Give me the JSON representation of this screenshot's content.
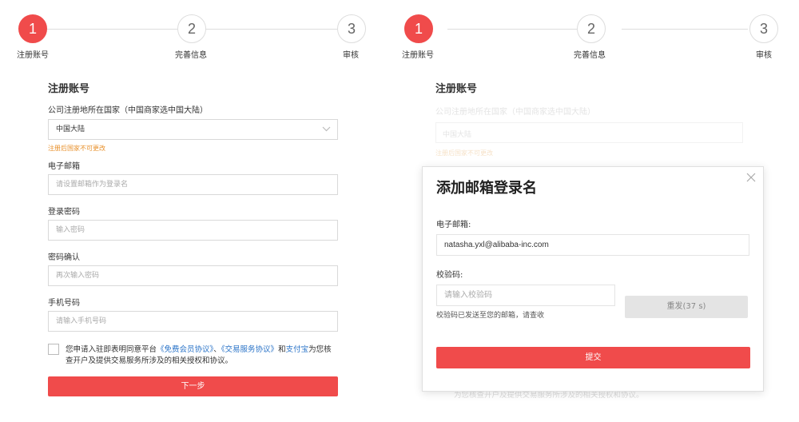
{
  "steps": [
    {
      "number": "1",
      "label": "注册账号",
      "state": "active"
    },
    {
      "number": "2",
      "label": "完善信息",
      "state": "inactive"
    },
    {
      "number": "3",
      "label": "审核",
      "state": "inactive"
    }
  ],
  "colors": {
    "accent": "#f04b4b",
    "link": "#2b74c8",
    "warning": "#e8912c"
  },
  "left_form": {
    "title": "注册账号",
    "country_label": "公司注册地所在国家（中国商家选中国大陆）",
    "country_value": "中国大陆",
    "country_hint": "注册后国家不可更改",
    "email_label": "电子邮箱",
    "email_placeholder": "请设置邮箱作为登录名",
    "password_label": "登录密码",
    "password_placeholder": "输入密码",
    "confirm_label": "密码确认",
    "confirm_placeholder": "再次输入密码",
    "phone_label": "手机号码",
    "phone_placeholder": "请输入手机号码",
    "agreement": {
      "prefix": "您申请入驻即表明同意平台",
      "link1": "《免费会员协议》",
      "sep": "、",
      "link2": "《交易服务协议》",
      "and": "和",
      "link3": "支付宝",
      "suffix": "为您核查开户及提供交易服务所涉及的相关授权和协议。"
    },
    "next_button": "下一步"
  },
  "right_background": {
    "title": "注册账号",
    "country_label": "公司注册地所在国家（中国商家选中国大陆）",
    "country_value": "中国大陆",
    "country_hint": "注册后国家不可更改",
    "bottom_text": "为您核查开户及提供交易服务所涉及的相关授权和协议。"
  },
  "modal": {
    "title": "添加邮箱登录名",
    "email_label": "电子邮箱:",
    "email_value": "natasha.yxl@alibaba-inc.com",
    "code_label": "校验码:",
    "code_placeholder": "请输入校验码",
    "code_hint": "校验码已发送至您的邮箱，请查收",
    "resend_button": "重发(37 s)",
    "submit_button": "提交"
  }
}
